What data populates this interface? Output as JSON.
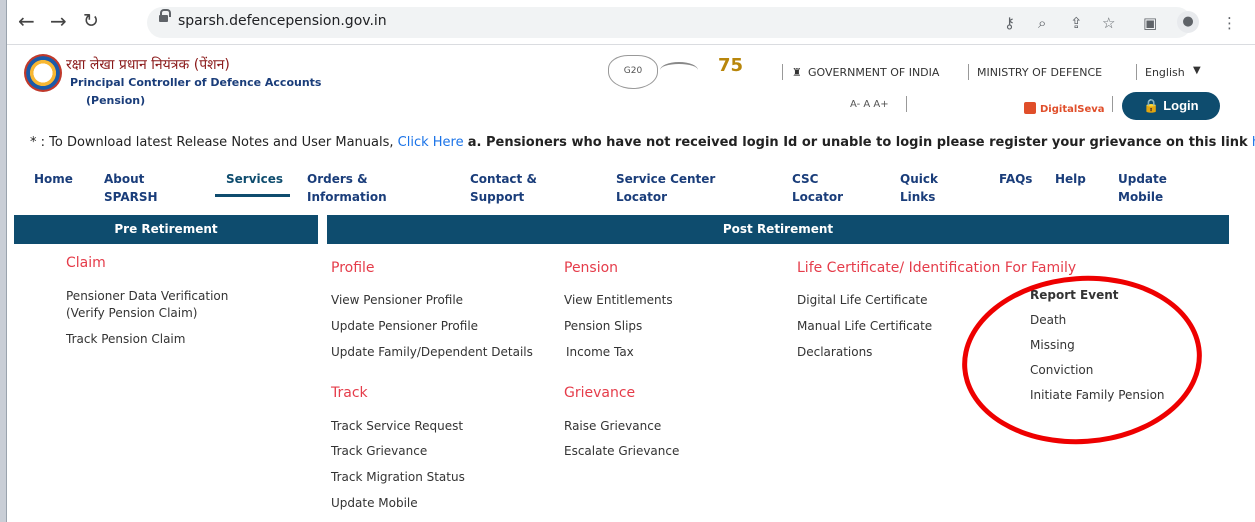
{
  "browser": {
    "url": "sparsh.defencepension.gov.in"
  },
  "header": {
    "hindi_title": "रक्षा लेखा प्रधान नियंत्रक (पेंशन)",
    "title_line1": "Principal Controller of Defence Accounts",
    "title_line2": "(Pension)",
    "gov": "GOVERNMENT OF INDIA",
    "ministry": "MINISTRY OF DEFENCE",
    "language": "English",
    "font_size": "A- A A+",
    "digiseva": "DigitalSeva",
    "login": "Login"
  },
  "notice": {
    "prefix": "* : To Download latest Release Notes and User Manuals,",
    "link": "Click Here",
    "bold": "a. Pensioners who have not received login Id or unable to login please register your grievance on this link",
    "tail": "ht"
  },
  "nav": [
    {
      "l1": "Home",
      "l2": ""
    },
    {
      "l1": "About",
      "l2": "SPARSH"
    },
    {
      "l1": "Services",
      "l2": ""
    },
    {
      "l1": "Orders &",
      "l2": "Information"
    },
    {
      "l1": "Contact &",
      "l2": "Support"
    },
    {
      "l1": "Service Center",
      "l2": "Locator"
    },
    {
      "l1": "CSC",
      "l2": "Locator"
    },
    {
      "l1": "Quick",
      "l2": "Links"
    },
    {
      "l1": "FAQs",
      "l2": ""
    },
    {
      "l1": "Help",
      "l2": ""
    },
    {
      "l1": "Update",
      "l2": "Mobile"
    }
  ],
  "menu": {
    "pre_title": "Pre Retirement",
    "post_title": "Post Retirement",
    "claim": {
      "heading": "Claim",
      "items": [
        "Pensioner Data Verification",
        "(Verify Pension Claim)",
        "Track Pension Claim"
      ]
    },
    "profile": {
      "heading": "Profile",
      "items": [
        "View Pensioner Profile",
        "Update Pensioner Profile",
        "Update Family/Dependent Details"
      ]
    },
    "pension": {
      "heading": "Pension",
      "items": [
        "View Entitlements",
        "Pension Slips",
        "Income Tax"
      ]
    },
    "life": {
      "heading": "Life Certificate/ Identification For Family",
      "items": [
        "Digital Life Certificate",
        "Manual Life Certificate",
        "Declarations"
      ]
    },
    "report": {
      "heading": "Report Event",
      "items": [
        "Death",
        "Missing",
        "Conviction",
        "Initiate Family Pension"
      ]
    },
    "track": {
      "heading": "Track",
      "items": [
        "Track Service Request",
        "Track Grievance",
        "Track Migration Status",
        "Update Mobile"
      ]
    },
    "grievance": {
      "heading": "Grievance",
      "items": [
        "Raise Grievance",
        "Escalate Grievance"
      ]
    }
  }
}
